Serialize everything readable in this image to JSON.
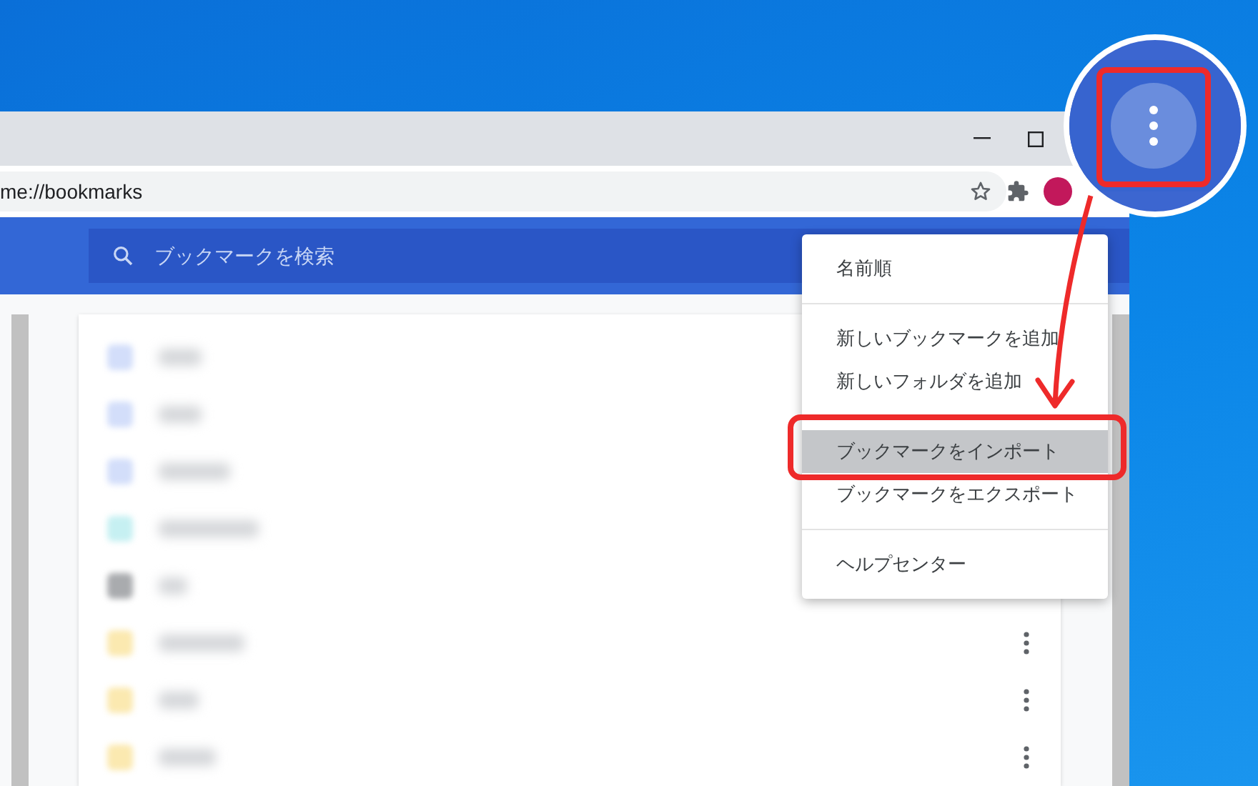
{
  "address_bar": {
    "value": "me://bookmarks"
  },
  "search": {
    "placeholder": "ブックマークを検索"
  },
  "bookmarks": [
    {
      "color": "#d3defa"
    },
    {
      "color": "#d3defa"
    },
    {
      "color": "#d3defa"
    },
    {
      "color": "#c6f0f2"
    },
    {
      "color": "#a9abae"
    },
    {
      "color": "#fbe9b0"
    },
    {
      "color": "#fbe9b0"
    },
    {
      "color": "#fbe9b0"
    }
  ],
  "menu": {
    "groups": [
      [
        {
          "label": "名前順",
          "selected": false
        }
      ],
      [
        {
          "label": "新しいブックマークを追加",
          "selected": false
        },
        {
          "label": "新しいフォルダを追加",
          "selected": false
        }
      ],
      [
        {
          "label": "ブックマークをインポート",
          "selected": true
        },
        {
          "label": "ブックマークをエクスポート",
          "selected": false
        }
      ],
      [
        {
          "label": "ヘルプセンター",
          "selected": false
        }
      ]
    ]
  }
}
